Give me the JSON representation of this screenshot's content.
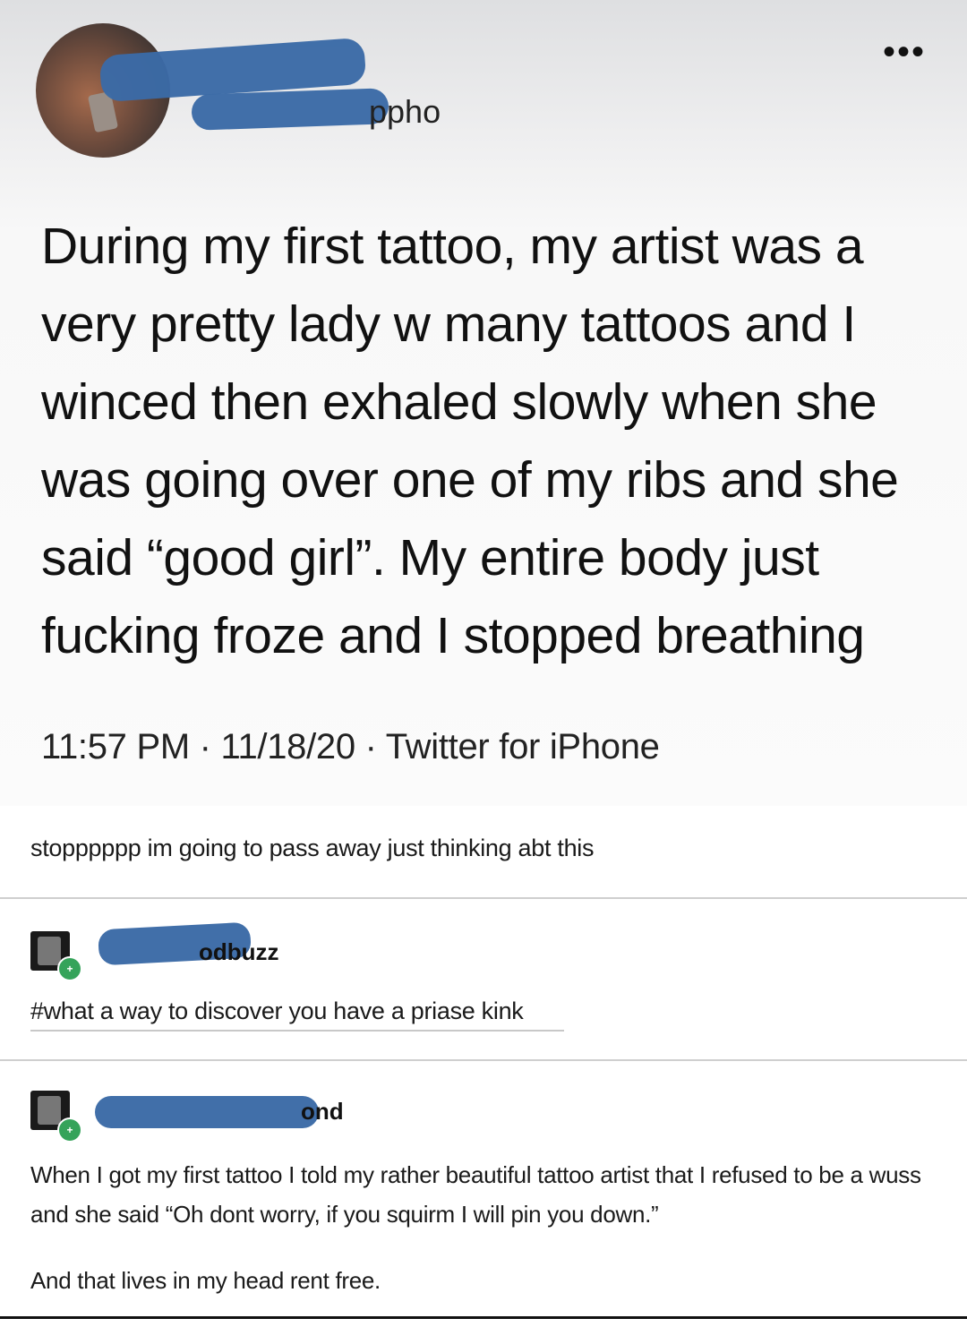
{
  "tweet": {
    "handle_tail": "ppho",
    "more_icon": "more-icon",
    "text": "During my first tattoo, my artist was a very pretty lady w many tattoos and I winced then exhaled slowly when she was going over one of my ribs and she said “good girl”. My entire body just fucking froze and I stopped breathing",
    "meta": "11:57 PM · 11/18/20 · Twitter for iPhone"
  },
  "reblog": {
    "text": "stopppppp im going to pass away just thinking abt this"
  },
  "comments": [
    {
      "username_tail": "odbuzz",
      "text": "#what a way to discover you have a priase kink"
    },
    {
      "username_tail": "ond",
      "paragraphs": [
        "When I got my first tattoo I told my rather beautiful tattoo artist that I refused to be a wuss and she said “Oh dont worry, if you squirm I will pin you down.”",
        "And that lives in my head rent free."
      ]
    }
  ],
  "colors": {
    "redaction": "#3b6aa6",
    "badge": "#35a35a"
  }
}
